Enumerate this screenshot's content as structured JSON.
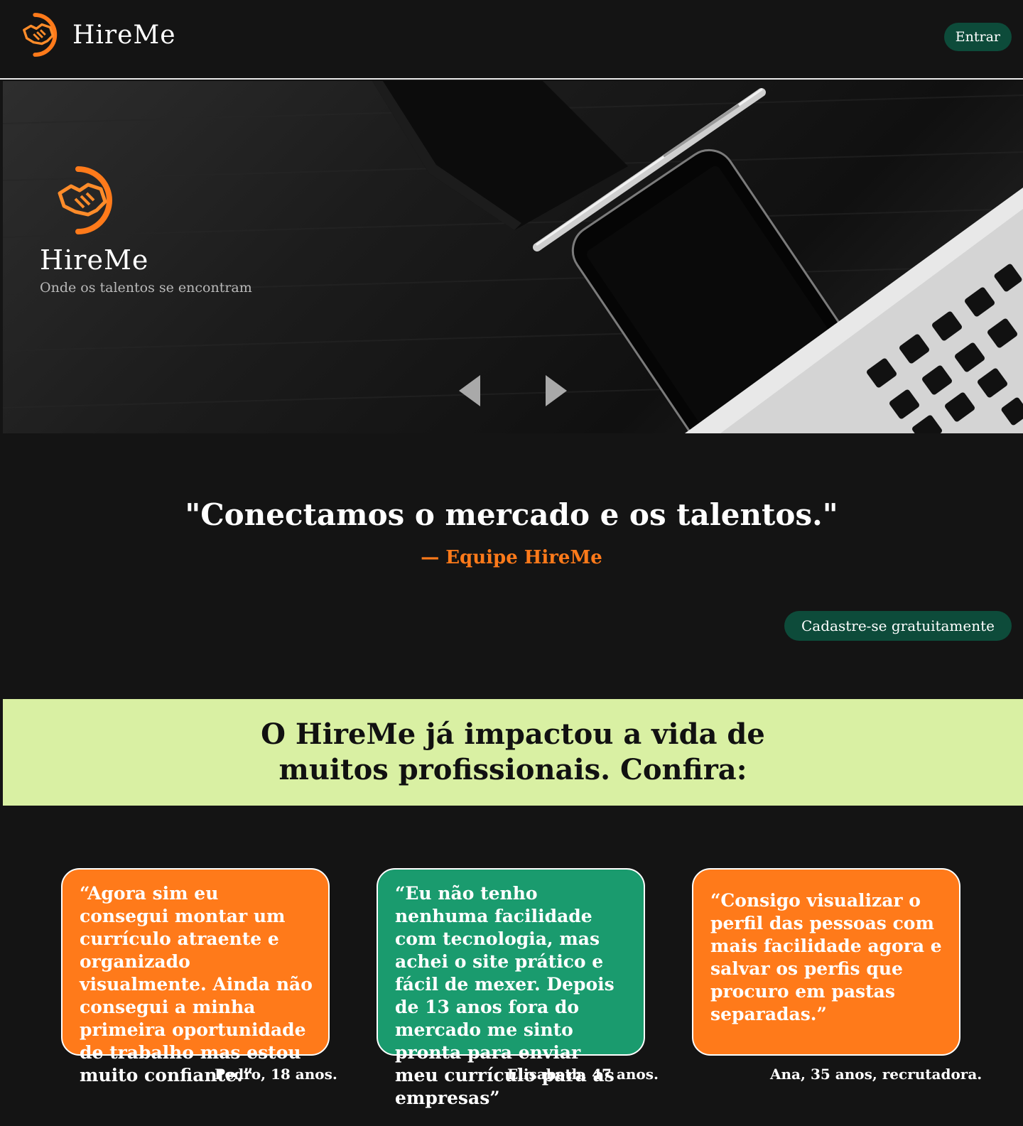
{
  "header": {
    "brand_name": "HireMe",
    "login_label": "Entrar",
    "logo_icon": "handshake-icon",
    "accent_color": "#ff7a1a",
    "button_color": "#0d4b3a"
  },
  "hero": {
    "title": "HireMe",
    "subtitle": "Onde os talentos se encontram",
    "logo_icon": "handshake-icon",
    "prev_icon": "chevron-left-icon",
    "next_icon": "chevron-right-icon"
  },
  "quote": {
    "text": "\"Conectamos o mercado e os talentos.\"",
    "author": "— Equipe HireMe"
  },
  "cta": {
    "label": "Cadastre-se gratuitamente"
  },
  "impact": {
    "text": "O HireMe já impactou a vida de muitos profissionais. Confira:",
    "background": "#d9f0a3"
  },
  "testimonials": [
    {
      "text": "“Agora sim eu consegui montar um currículo atraente e organizado visualmente. Ainda não consegui a minha primeira oportunidade de trabalho mas estou muito confiante.”",
      "author": "Pedro, 18 anos.",
      "color": "#ff7a1a"
    },
    {
      "text": "“Eu não tenho nenhuma facilidade com tecnologia, mas achei o site prático e fácil de mexer. Depois de 13 anos fora do mercado me sinto pronta para enviar meu currículo para as empresas”",
      "author": "Elisabeth, 47 anos.",
      "color": "#1a9b6e"
    },
    {
      "text": "“Consigo visualizar o perfil das pessoas com mais facilidade agora e salvar os perfis que procuro em pastas separadas.”",
      "author": "Ana, 35 anos, recrutadora.",
      "color": "#ff7a1a"
    }
  ]
}
